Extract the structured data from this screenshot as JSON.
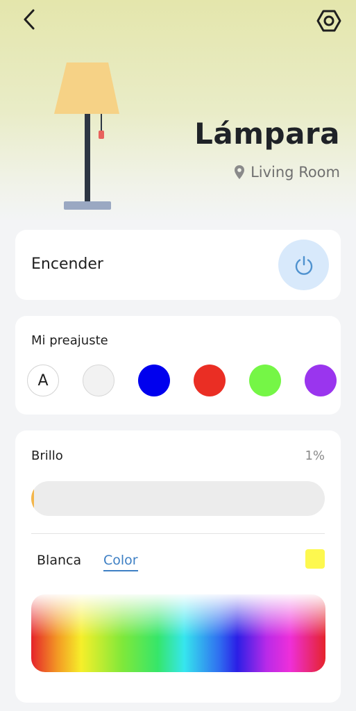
{
  "header": {
    "back_icon": "chevron-left-icon",
    "settings_icon": "hexagon-gear-icon"
  },
  "device": {
    "name": "Lámpara",
    "location": "Living Room",
    "location_icon": "map-pin-icon"
  },
  "power": {
    "label": "Encender",
    "icon": "power-icon",
    "button_color": "#d8e9fb"
  },
  "presets": {
    "title": "Mi preajuste",
    "auto_label": "A",
    "colors": [
      "#f2f2f2",
      "#0000ee",
      "#ea2e24",
      "#75f646",
      "#9a35ee"
    ]
  },
  "brightness": {
    "label": "Brillo",
    "value_text": "1%",
    "value": 1,
    "fill_color": "#f3b64c"
  },
  "mode": {
    "tabs": [
      "Blanca",
      "Color"
    ],
    "active": "Color",
    "current_color": "#fdf84f"
  }
}
